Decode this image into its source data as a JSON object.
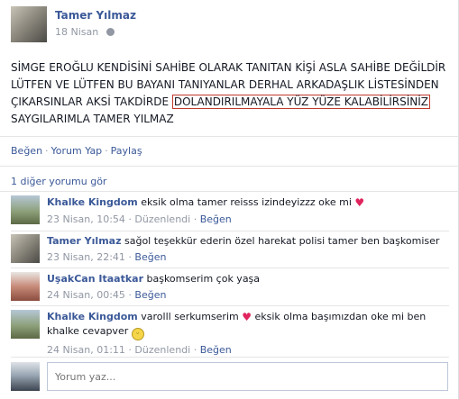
{
  "post": {
    "author": "Tamer Yılmaz",
    "date": "18 Nisan",
    "privacy_icon": "globe-icon",
    "text_before": "SİMGE EROĞLU KENDİSİNİ SAHİBE OLARAK TANITAN KİŞİ ASLA SAHİBE DEĞİLDİR LÜTFEN VE LÜTFEN BU BAYANI TANIYANLAR DERHAL ARKADAŞLIK LİSTESİNDEN ÇIKARSINLAR AKSİ TAKDİRDE ",
    "text_highlight": "DOLANDIRILMAYALA YÜZ YÜZE KALABİLİRSİNİZ",
    "text_after": " SAYGILARIMLA TAMER YILMAZ",
    "highlight_color": "#c0392b"
  },
  "actions": {
    "like": "Beğen",
    "comment": "Yorum Yap",
    "share": "Paylaş",
    "separator": "·"
  },
  "view_more": "1 diğer yorumu gör",
  "comments": [
    {
      "author": "Khalke Kingdom",
      "text": "eksik olma tamer reisss izindeyizzz oke mi",
      "emoji": "heart-icon",
      "date": "23 Nisan, 10:54",
      "edited": "Düzenlendi",
      "like": "Beğen"
    },
    {
      "author": "Tamer Yılmaz",
      "text": "sağol teşekkür ederin özel harekat polisi tamer ben başkomiser",
      "date": "23 Nisan, 22:41",
      "like": "Beğen"
    },
    {
      "author": "UşakCan Itaatkar",
      "text": "başkomserim çok yaşa",
      "date": "24 Nisan, 00:45",
      "like": "Beğen"
    },
    {
      "author": "Khalke Kingdom",
      "text_before": "varolll serkumserim",
      "text_after": "eksik olma başımızdan oke mi ben khalke cevapver",
      "emoji": "heart-icon",
      "emoji2": "smile-icon",
      "date": "24 Nisan, 01:11",
      "edited": "Düzenlendi",
      "like": "Beğen"
    }
  ],
  "compose": {
    "placeholder": "Yorum yaz..."
  },
  "colors": {
    "link": "#3b5998",
    "meta": "#9197a3",
    "heart": "#e0245e"
  }
}
